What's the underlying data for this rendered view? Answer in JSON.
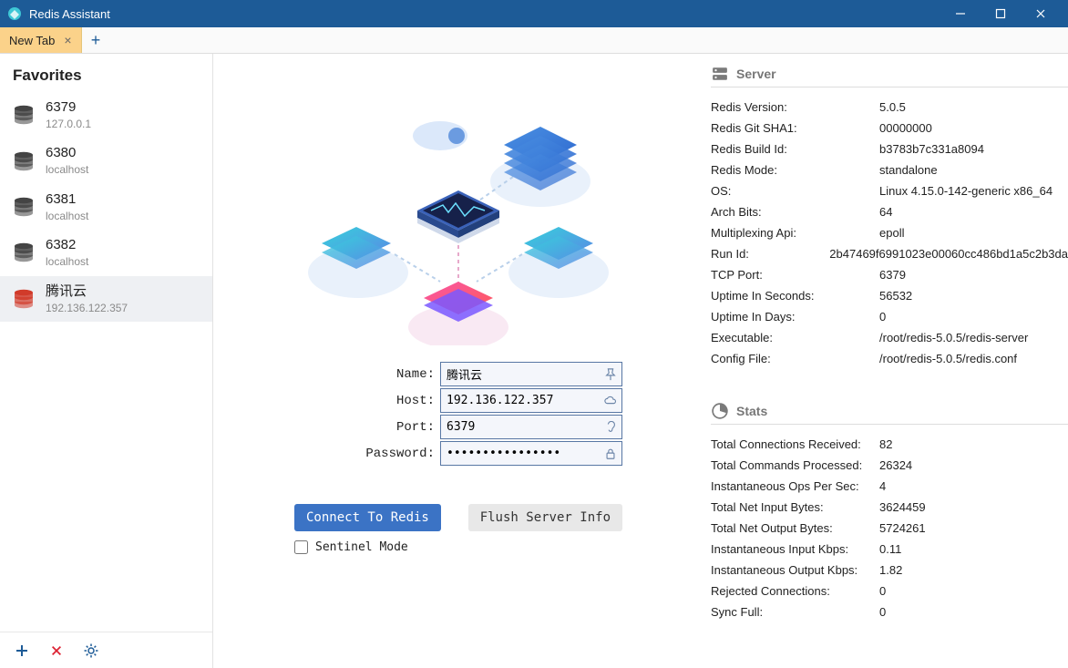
{
  "window": {
    "title": "Redis Assistant"
  },
  "tabs": {
    "active_label": "New Tab"
  },
  "sidebar": {
    "heading": "Favorites",
    "items": [
      {
        "name": "6379",
        "host": "127.0.0.1"
      },
      {
        "name": "6380",
        "host": "localhost"
      },
      {
        "name": "6381",
        "host": "localhost"
      },
      {
        "name": "6382",
        "host": "localhost"
      },
      {
        "name": "腾讯云",
        "host": "192.136.122.357"
      }
    ]
  },
  "form": {
    "labels": {
      "name": "Name:",
      "host": "Host:",
      "port": "Port:",
      "password": "Password:"
    },
    "values": {
      "name": "腾讯云",
      "host": "192.136.122.357",
      "port": "6379",
      "password": "••••••••••••••••"
    },
    "connect_btn": "Connect To Redis",
    "flush_btn": "Flush Server Info",
    "sentinel_label": "Sentinel Mode",
    "sentinel_checked": false
  },
  "server_panel": {
    "title": "Server",
    "rows": [
      {
        "k": "Redis Version:",
        "v": "5.0.5"
      },
      {
        "k": "Redis Git SHA1:",
        "v": "00000000"
      },
      {
        "k": "Redis Build Id:",
        "v": "b3783b7c331a8094"
      },
      {
        "k": "Redis Mode:",
        "v": "standalone"
      },
      {
        "k": "OS:",
        "v": "Linux 4.15.0-142-generic x86_64"
      },
      {
        "k": "Arch Bits:",
        "v": "64"
      },
      {
        "k": "Multiplexing Api:",
        "v": "epoll"
      },
      {
        "k": "Run Id:",
        "v": "2b47469f6991023e00060cc486bd1a5c2b3da"
      },
      {
        "k": "TCP Port:",
        "v": "6379"
      },
      {
        "k": "Uptime In Seconds:",
        "v": "56532"
      },
      {
        "k": "Uptime In Days:",
        "v": "0"
      },
      {
        "k": "Executable:",
        "v": "/root/redis-5.0.5/redis-server"
      },
      {
        "k": "Config File:",
        "v": "/root/redis-5.0.5/redis.conf"
      }
    ]
  },
  "stats_panel": {
    "title": "Stats",
    "rows": [
      {
        "k": "Total Connections Received:",
        "v": "82"
      },
      {
        "k": "Total Commands Processed:",
        "v": "26324"
      },
      {
        "k": "Instantaneous Ops Per Sec:",
        "v": "4"
      },
      {
        "k": "Total Net Input Bytes:",
        "v": "3624459"
      },
      {
        "k": "Total Net Output Bytes:",
        "v": "5724261"
      },
      {
        "k": "Instantaneous Input Kbps:",
        "v": "0.11"
      },
      {
        "k": "Instantaneous Output Kbps:",
        "v": "1.82"
      },
      {
        "k": "Rejected Connections:",
        "v": "0"
      },
      {
        "k": "Sync Full:",
        "v": "0"
      }
    ]
  }
}
